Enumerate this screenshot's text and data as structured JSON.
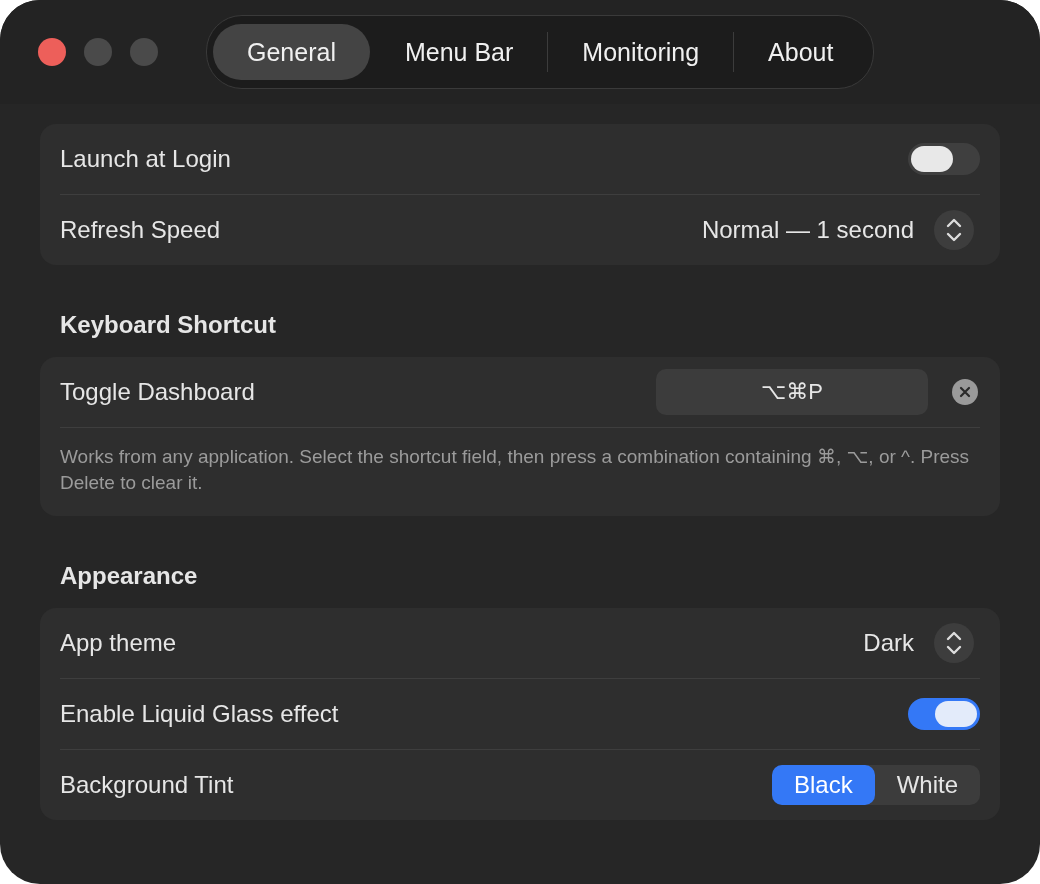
{
  "tabs": [
    {
      "label": "General",
      "selected": true
    },
    {
      "label": "Menu Bar",
      "selected": false
    },
    {
      "label": "Monitoring",
      "selected": false
    },
    {
      "label": "About",
      "selected": false
    }
  ],
  "sections": [
    {
      "rows": [
        {
          "kind": "toggle",
          "label": "Launch at Login",
          "on": false
        },
        {
          "kind": "popup",
          "label": "Refresh Speed",
          "value": "Normal — 1 second"
        }
      ]
    },
    {
      "title": "Keyboard Shortcut",
      "rows": [
        {
          "kind": "shortcut",
          "label": "Toggle Dashboard",
          "value": "⌥⌘P"
        }
      ],
      "note": "Works from any application. Select the shortcut field, then press a combination containing ⌘, ⌥, or ^. Press Delete to clear it."
    },
    {
      "title": "Appearance",
      "rows": [
        {
          "kind": "popup",
          "label": "App theme",
          "value": "Dark"
        },
        {
          "kind": "toggle",
          "label": "Enable Liquid Glass effect",
          "on": true
        },
        {
          "kind": "segmented",
          "label": "Background Tint",
          "options": [
            {
              "label": "Black",
              "selected": true
            },
            {
              "label": "White",
              "selected": false
            }
          ]
        }
      ]
    }
  ]
}
